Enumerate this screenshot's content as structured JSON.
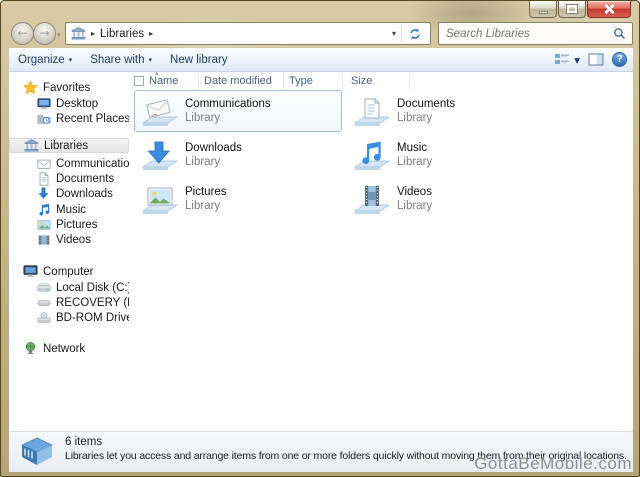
{
  "window": {
    "watermark": "GottaBeMobile.com"
  },
  "icons": {
    "back_arrow": "←",
    "forward_arrow": "→",
    "nav_history_chevron": "▾",
    "breadcrumb_arrow": "▸",
    "address_chevron": "▾",
    "dropdown_chevron": "▾",
    "sort_ascending_caret": "▴",
    "help_glyph": "?",
    "named_shapes": [
      "minimize-icon",
      "maximize-icon",
      "close-icon",
      "libraries-icon",
      "refresh-icon",
      "search-icon",
      "views-icon",
      "preview-pane-icon",
      "help-icon",
      "star-icon",
      "desktop-icon",
      "recent-places-icon",
      "envelope-icon",
      "document-icon",
      "download-arrow-icon",
      "music-note-icon",
      "picture-icon",
      "film-icon",
      "computer-icon",
      "disk-drive-icon",
      "disc-drive-icon",
      "network-icon",
      "library-box-icon"
    ]
  },
  "navbar": {
    "breadcrumb_root": "Libraries",
    "search_placeholder": "Search Libraries"
  },
  "toolbar": {
    "organize": "Organize",
    "share_with": "Share with",
    "new_library": "New library"
  },
  "columns": {
    "name": "Name",
    "date_modified": "Date modified",
    "type": "Type",
    "size": "Size"
  },
  "sidebar": {
    "sections": [
      {
        "label": "Favorites",
        "items": [
          {
            "label": "Desktop"
          },
          {
            "label": "Recent Places"
          }
        ]
      },
      {
        "label": "Libraries",
        "selected": true,
        "items": [
          {
            "label": "Communications"
          },
          {
            "label": "Documents"
          },
          {
            "label": "Downloads"
          },
          {
            "label": "Music"
          },
          {
            "label": "Pictures"
          },
          {
            "label": "Videos"
          }
        ]
      },
      {
        "label": "Computer",
        "items": [
          {
            "label": "Local Disk (C:)"
          },
          {
            "label": "RECOVERY (D:)"
          },
          {
            "label": "BD-ROM Drive (E:) ("
          }
        ]
      },
      {
        "label": "Network",
        "items": []
      }
    ]
  },
  "content": {
    "items": [
      {
        "name": "Communications",
        "kind": "Library",
        "selected": true
      },
      {
        "name": "Documents",
        "kind": "Library"
      },
      {
        "name": "Downloads",
        "kind": "Library"
      },
      {
        "name": "Music",
        "kind": "Library"
      },
      {
        "name": "Pictures",
        "kind": "Library"
      },
      {
        "name": "Videos",
        "kind": "Library"
      }
    ]
  },
  "statusbar": {
    "count": "6 items",
    "description": "Libraries let you access and arrange items from one or more folders quickly without moving them from their original locations."
  },
  "colors": {
    "glass_tan": "#c9ba92",
    "accent_blue": "#2f7ed0",
    "selection_border": "#a0bddc",
    "close_button_red": "#c03a2e",
    "toolbar_text": "#1e3c64",
    "column_header_text": "#44618a"
  }
}
